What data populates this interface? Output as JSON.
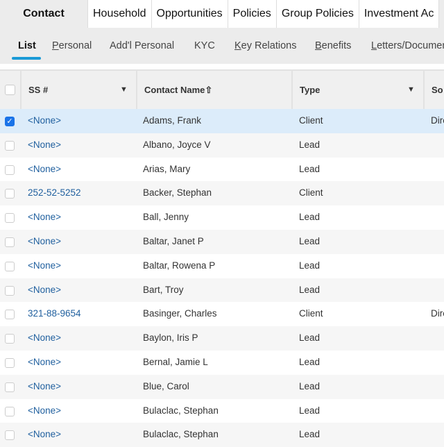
{
  "tabs": [
    "Contact",
    "Household",
    "Opportunities",
    "Policies",
    "Group Policies",
    "Investment Ac"
  ],
  "subtabs": [
    {
      "label": "List",
      "u": ""
    },
    {
      "label": "Personal",
      "u": "P"
    },
    {
      "label": "Add'l Personal",
      "u": ""
    },
    {
      "label": "KYC",
      "u": ""
    },
    {
      "label": "Key Relations",
      "u": "K"
    },
    {
      "label": "Benefits",
      "u": "B"
    },
    {
      "label": "Letters/Documen",
      "u": "L"
    }
  ],
  "columns": {
    "ss": "SS #",
    "name": "Contact Name",
    "sort_icon": "⇧",
    "type": "Type",
    "source": "So"
  },
  "accent": "#1a9ad6",
  "rows": [
    {
      "ss": "<None>",
      "name": "Adams, Frank",
      "type": "Client",
      "source": "Dire",
      "checked": true
    },
    {
      "ss": "<None>",
      "name": "Albano, Joyce V",
      "type": "Lead",
      "source": ""
    },
    {
      "ss": "<None>",
      "name": "Arias, Mary",
      "type": "Lead",
      "source": ""
    },
    {
      "ss": "252-52-5252",
      "name": "Backer, Stephan",
      "type": "Client",
      "source": ""
    },
    {
      "ss": "<None>",
      "name": "Ball, Jenny",
      "type": "Lead",
      "source": ""
    },
    {
      "ss": "<None>",
      "name": "Baltar, Janet P",
      "type": "Lead",
      "source": ""
    },
    {
      "ss": "<None>",
      "name": "Baltar, Rowena P",
      "type": "Lead",
      "source": ""
    },
    {
      "ss": "<None>",
      "name": "Bart, Troy",
      "type": "Lead",
      "source": ""
    },
    {
      "ss": "321-88-9654",
      "name": "Basinger, Charles",
      "type": "Client",
      "source": "Dire"
    },
    {
      "ss": "<None>",
      "name": "Baylon, Iris P",
      "type": "Lead",
      "source": ""
    },
    {
      "ss": "<None>",
      "name": "Bernal, Jamie L",
      "type": "Lead",
      "source": ""
    },
    {
      "ss": "<None>",
      "name": "Blue, Carol",
      "type": "Lead",
      "source": ""
    },
    {
      "ss": "<None>",
      "name": "Bulaclac, Stephan",
      "type": "Lead",
      "source": ""
    },
    {
      "ss": "<None>",
      "name": "Bulaclac, Stephan",
      "type": "Lead",
      "source": ""
    }
  ]
}
